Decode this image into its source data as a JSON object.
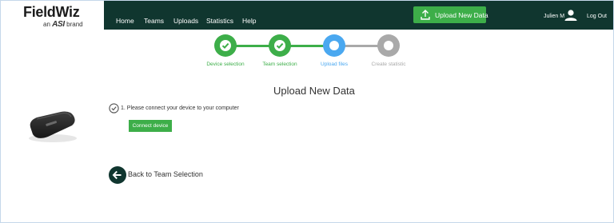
{
  "logo": {
    "name": "FieldWiz",
    "tagline_pre": "an",
    "tagline_brand": "ASI",
    "tagline_post": "brand"
  },
  "nav": [
    "Home",
    "Teams",
    "Uploads",
    "Statistics",
    "Help"
  ],
  "upload_button": {
    "label": "Upload New Data",
    "icon": "upload-icon"
  },
  "user": {
    "name": "Julien M",
    "icon": "user-icon",
    "logout": "Log Out"
  },
  "steps": [
    {
      "label": "Device selection",
      "state": "done"
    },
    {
      "label": "Team selection",
      "state": "done"
    },
    {
      "label": "Upload files",
      "state": "active"
    },
    {
      "label": "Create statistic",
      "state": "pending"
    }
  ],
  "page_title": "Upload New Data",
  "instruction": "1. Please connect your device to your computer",
  "connect_button": "Connect device",
  "back_link": "Back to Team Selection",
  "colors": {
    "header": "#10362f",
    "accent_green": "#3dae49",
    "active_blue": "#4aa8f0",
    "pending_gray": "#a9a9a9"
  }
}
